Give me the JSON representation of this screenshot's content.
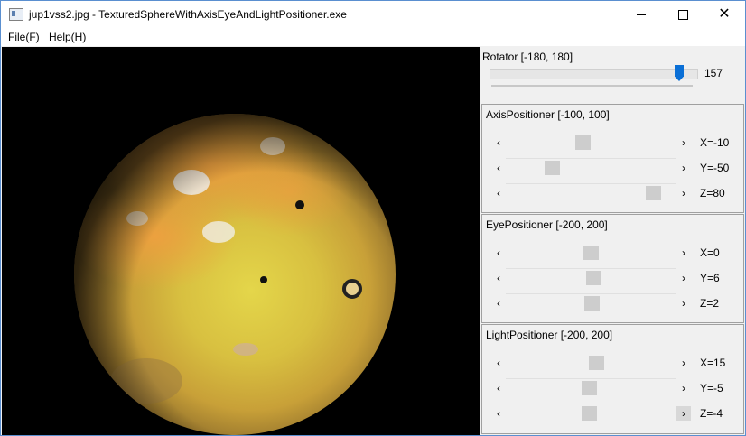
{
  "window": {
    "title": "jup1vss2.jpg - TexturedSphereWithAxisEyeAndLightPositioner.exe",
    "controls": {
      "minimize": "minimize",
      "maximize": "maximize",
      "close": "✕"
    }
  },
  "menu": {
    "items": [
      "File(F)",
      "Help(H)"
    ]
  },
  "rotator": {
    "title": "Rotator [-180, 180]",
    "value": "157",
    "fraction": 0.936
  },
  "axis": {
    "title": "AxisPositioner [-100, 100]",
    "rows": [
      {
        "label": "X=-10",
        "fraction": 0.45
      },
      {
        "label": "Y=-50",
        "fraction": 0.25
      },
      {
        "label": "Z=80",
        "fraction": 0.9
      }
    ]
  },
  "eye": {
    "title": "EyePositioner [-200, 200]",
    "rows": [
      {
        "label": "X=0",
        "fraction": 0.5
      },
      {
        "label": "Y=6",
        "fraction": 0.515
      },
      {
        "label": "Z=2",
        "fraction": 0.505
      }
    ]
  },
  "light": {
    "title": "LightPositioner [-200, 200]",
    "rows": [
      {
        "label": "X=15",
        "fraction": 0.5375
      },
      {
        "label": "Y=-5",
        "fraction": 0.4875
      },
      {
        "label": "Z=-4",
        "fraction": 0.49
      }
    ]
  },
  "scrollbar_glyphs": {
    "left": "‹",
    "right": "›"
  },
  "colors": {
    "accent": "#0a6fd6",
    "viewport_bg": "#000000"
  }
}
